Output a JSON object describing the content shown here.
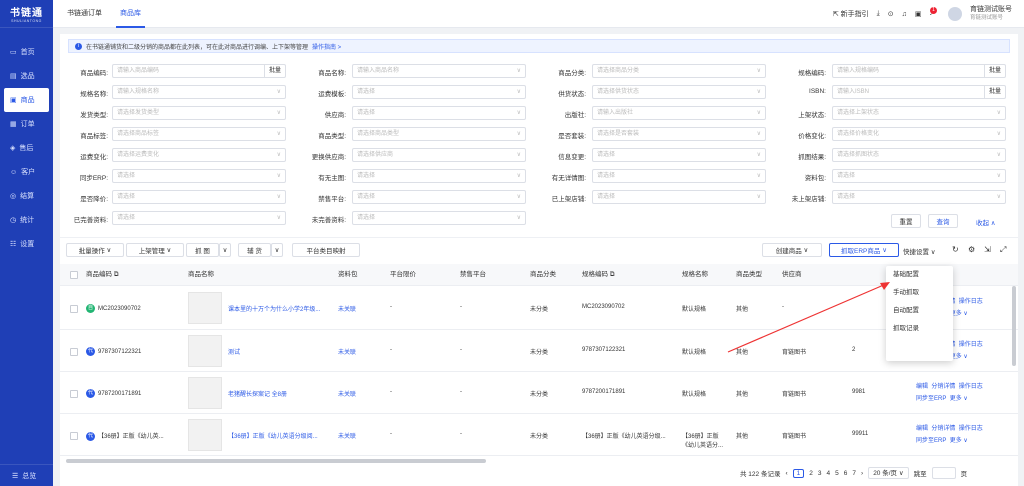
{
  "sidebar": {
    "logo": "书链通",
    "logo_sub": "SHULIANTONG",
    "items": [
      "首页",
      "选品",
      "商品",
      "订单",
      "售后",
      "客户",
      "结算",
      "统计",
      "设置"
    ],
    "footer": "总览"
  },
  "topbar": {
    "tabs": [
      "书链通订单",
      "商品库"
    ],
    "guide": "新手指引",
    "badge": "1",
    "user_name": "育链测试账号",
    "user_sub": "育链测试账号"
  },
  "notice": {
    "text": "在书链通铺货和二级分销的商品都在此列表，可在此对商品进行调编、上下架等管理",
    "link": "操作指南 >"
  },
  "filters": {
    "r1": {
      "l1": "商品编码:",
      "p1": "请输入商品编码",
      "b1": "批量",
      "l2": "商品名称:",
      "p2": "请输入商品名称",
      "l3": "商品分类:",
      "p3": "请选择商品分类",
      "l4": "规格编码:",
      "p4": "请输入规格编码",
      "b4": "批量"
    },
    "r2": {
      "l1": "规格名称:",
      "p1": "请输入规格名称",
      "l2": "运费模板:",
      "p2": "请选择",
      "l3": "供货状态:",
      "p3": "请选择供货状态",
      "l4": "ISBN:",
      "p4": "请输入ISBN",
      "b4": "批量"
    },
    "r3": {
      "l1": "发货类型:",
      "p1": "请选择发货类型",
      "l2": "供应商:",
      "p2": "请选择",
      "l3": "出版社:",
      "p3": "请输入出版社",
      "l4": "上架状态:",
      "p4": "请选择上架状态"
    },
    "r4": {
      "l1": "商品标签:",
      "p1": "请选择商品标签",
      "l2": "商品类型:",
      "p2": "请选择商品类型",
      "l3": "是否套装:",
      "p3": "请选择是否套装",
      "l4": "价格变化:",
      "p4": "请选择价格变化"
    },
    "r5": {
      "l1": "运费变化:",
      "p1": "请选择运费变化",
      "l2": "更换供应商:",
      "p2": "请选择供应商",
      "l3": "信息变更:",
      "p3": "请选择",
      "l4": "抓图结果:",
      "p4": "请选择抓图状态"
    },
    "r6": {
      "l1": "同步ERP:",
      "p1": "请选择",
      "l2": "有无主图:",
      "p2": "请选择",
      "l3": "有无详情图:",
      "p3": "请选择",
      "l4": "资料包:",
      "p4": "请选择"
    },
    "r7": {
      "l1": "是否降价:",
      "p1": "请选择",
      "l2": "禁售平台:",
      "p2": "请选择",
      "l3": "已上架店铺:",
      "p3": "请选择",
      "l4": "未上架店铺:",
      "p4": "请选择"
    },
    "r8": {
      "l1": "已完善资料:",
      "p1": "请选择",
      "l2": "未完善资料:",
      "p2": "请选择"
    },
    "reset": "重置",
    "query": "查询",
    "collapse": "收起 ∧"
  },
  "toolbar": {
    "batch": "批量操作",
    "shelf": "上架管理",
    "grab": "抓 图",
    "assist": "辅 货",
    "map": "平台类目映射",
    "create": "创建商品",
    "erp": "抓取ERP商品",
    "quick": "快捷设置"
  },
  "dropdown": [
    "基础配置",
    "手动抓取",
    "自动配置",
    "抓取记录"
  ],
  "table": {
    "headers": [
      "商品编码",
      "商品名称",
      "资料包",
      "平台限价",
      "禁售平台",
      "商品分类",
      "规格编码",
      "规格名称",
      "商品类型",
      "供应商",
      "",
      "操作"
    ],
    "rows": [
      {
        "chip": "自",
        "chip_color": "#22b573",
        "code": "MC2023090702",
        "name": "课本里的十万个为什么小学2年级...",
        "pkg": "未关联",
        "limit": "-",
        "ban": "-",
        "cat": "未分类",
        "spec": "MC2023090702",
        "specname": "默认规格",
        "type": "其他",
        "supplier": "-",
        "stock": "",
        "ops": [
          "编辑",
          "分销详情",
          "操作日志",
          "同步至ERP",
          "更多"
        ]
      },
      {
        "chip": "代",
        "chip_color": "#2b59e6",
        "code": "9787307122321",
        "name": "测试",
        "pkg": "未关联",
        "limit": "-",
        "ban": "-",
        "cat": "未分类",
        "spec": "9787307122321",
        "specname": "默认规格",
        "type": "其他",
        "supplier": "育链图书",
        "stock": "2",
        "ops": [
          "编辑",
          "分销详情",
          "操作日志",
          "同步至ERP",
          "更多"
        ]
      },
      {
        "chip": "代",
        "chip_color": "#2b59e6",
        "code": "9787200171891",
        "name": "老猪醒长探案记 全8册",
        "pkg": "未关联",
        "limit": "-",
        "ban": "-",
        "cat": "未分类",
        "spec": "9787200171891",
        "specname": "默认规格",
        "type": "其他",
        "supplier": "育链图书",
        "stock": "9981",
        "ops": [
          "编辑",
          "分销详情",
          "操作日志",
          "同步至ERP",
          "更多"
        ]
      },
      {
        "chip": "代",
        "chip_color": "#2b59e6",
        "code": "【36册】正版《幼儿英...",
        "name": "【36册】正版《幼儿英语分级阅...",
        "pkg": "未关联",
        "limit": "-",
        "ban": "-",
        "cat": "未分类",
        "spec": "【36册】正版《幼儿英语分级...",
        "specname": "【36册】正版《幼儿英语分...",
        "type": "其他",
        "supplier": "育链图书",
        "stock": "99911",
        "ops": [
          "编辑",
          "分销详情",
          "操作日志",
          "同步至ERP",
          "更多"
        ]
      }
    ]
  },
  "pager": {
    "total": "共 122 条记录",
    "pages": [
      "1",
      "2",
      "3",
      "4",
      "5",
      "6",
      "7"
    ],
    "per": "20 条/页",
    "jump": "跳至",
    "unit": "页"
  }
}
